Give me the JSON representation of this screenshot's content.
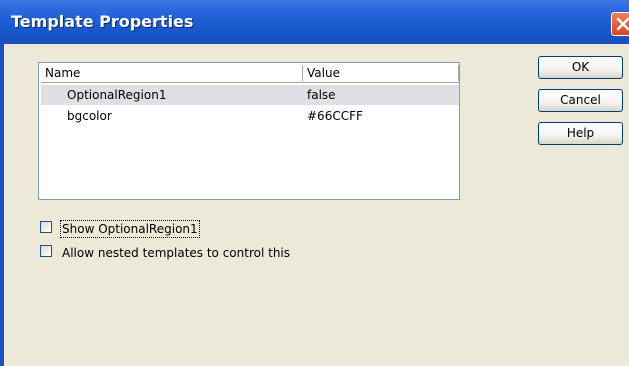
{
  "window": {
    "title": "Template Properties"
  },
  "table": {
    "columns": [
      "Name",
      "Value"
    ],
    "rows": [
      {
        "name": "OptionalRegion1",
        "value": "false",
        "selected": true
      },
      {
        "name": "bgcolor",
        "value": "#66CCFF",
        "selected": false
      }
    ]
  },
  "options": {
    "show_label": "Show OptionalRegion1",
    "show_checked": false,
    "nested_label": "Allow nested templates to control this",
    "nested_checked": false
  },
  "buttons": {
    "ok": "OK",
    "cancel": "Cancel",
    "help": "Help"
  },
  "colors": {
    "titlebar": "#1f5fd6",
    "dialog_bg": "#ece9d8",
    "selected_row": "#e0dfe3",
    "close_button": "#d8431f"
  },
  "icons": {
    "close": "close-icon"
  }
}
